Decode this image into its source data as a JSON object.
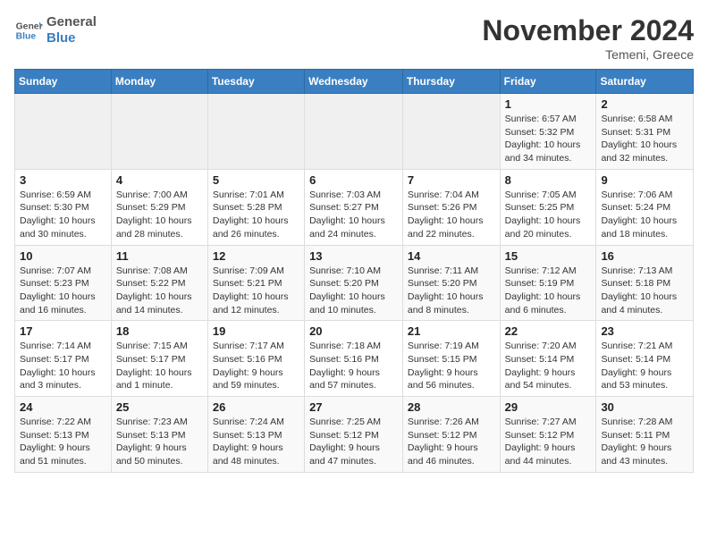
{
  "logo": {
    "text_general": "General",
    "text_blue": "Blue"
  },
  "title": "November 2024",
  "location": "Temeni, Greece",
  "days_of_week": [
    "Sunday",
    "Monday",
    "Tuesday",
    "Wednesday",
    "Thursday",
    "Friday",
    "Saturday"
  ],
  "weeks": [
    [
      {
        "day": "",
        "info": ""
      },
      {
        "day": "",
        "info": ""
      },
      {
        "day": "",
        "info": ""
      },
      {
        "day": "",
        "info": ""
      },
      {
        "day": "",
        "info": ""
      },
      {
        "day": "1",
        "info": "Sunrise: 6:57 AM\nSunset: 5:32 PM\nDaylight: 10 hours and 34 minutes."
      },
      {
        "day": "2",
        "info": "Sunrise: 6:58 AM\nSunset: 5:31 PM\nDaylight: 10 hours and 32 minutes."
      }
    ],
    [
      {
        "day": "3",
        "info": "Sunrise: 6:59 AM\nSunset: 5:30 PM\nDaylight: 10 hours and 30 minutes."
      },
      {
        "day": "4",
        "info": "Sunrise: 7:00 AM\nSunset: 5:29 PM\nDaylight: 10 hours and 28 minutes."
      },
      {
        "day": "5",
        "info": "Sunrise: 7:01 AM\nSunset: 5:28 PM\nDaylight: 10 hours and 26 minutes."
      },
      {
        "day": "6",
        "info": "Sunrise: 7:03 AM\nSunset: 5:27 PM\nDaylight: 10 hours and 24 minutes."
      },
      {
        "day": "7",
        "info": "Sunrise: 7:04 AM\nSunset: 5:26 PM\nDaylight: 10 hours and 22 minutes."
      },
      {
        "day": "8",
        "info": "Sunrise: 7:05 AM\nSunset: 5:25 PM\nDaylight: 10 hours and 20 minutes."
      },
      {
        "day": "9",
        "info": "Sunrise: 7:06 AM\nSunset: 5:24 PM\nDaylight: 10 hours and 18 minutes."
      }
    ],
    [
      {
        "day": "10",
        "info": "Sunrise: 7:07 AM\nSunset: 5:23 PM\nDaylight: 10 hours and 16 minutes."
      },
      {
        "day": "11",
        "info": "Sunrise: 7:08 AM\nSunset: 5:22 PM\nDaylight: 10 hours and 14 minutes."
      },
      {
        "day": "12",
        "info": "Sunrise: 7:09 AM\nSunset: 5:21 PM\nDaylight: 10 hours and 12 minutes."
      },
      {
        "day": "13",
        "info": "Sunrise: 7:10 AM\nSunset: 5:20 PM\nDaylight: 10 hours and 10 minutes."
      },
      {
        "day": "14",
        "info": "Sunrise: 7:11 AM\nSunset: 5:20 PM\nDaylight: 10 hours and 8 minutes."
      },
      {
        "day": "15",
        "info": "Sunrise: 7:12 AM\nSunset: 5:19 PM\nDaylight: 10 hours and 6 minutes."
      },
      {
        "day": "16",
        "info": "Sunrise: 7:13 AM\nSunset: 5:18 PM\nDaylight: 10 hours and 4 minutes."
      }
    ],
    [
      {
        "day": "17",
        "info": "Sunrise: 7:14 AM\nSunset: 5:17 PM\nDaylight: 10 hours and 3 minutes."
      },
      {
        "day": "18",
        "info": "Sunrise: 7:15 AM\nSunset: 5:17 PM\nDaylight: 10 hours and 1 minute."
      },
      {
        "day": "19",
        "info": "Sunrise: 7:17 AM\nSunset: 5:16 PM\nDaylight: 9 hours and 59 minutes."
      },
      {
        "day": "20",
        "info": "Sunrise: 7:18 AM\nSunset: 5:16 PM\nDaylight: 9 hours and 57 minutes."
      },
      {
        "day": "21",
        "info": "Sunrise: 7:19 AM\nSunset: 5:15 PM\nDaylight: 9 hours and 56 minutes."
      },
      {
        "day": "22",
        "info": "Sunrise: 7:20 AM\nSunset: 5:14 PM\nDaylight: 9 hours and 54 minutes."
      },
      {
        "day": "23",
        "info": "Sunrise: 7:21 AM\nSunset: 5:14 PM\nDaylight: 9 hours and 53 minutes."
      }
    ],
    [
      {
        "day": "24",
        "info": "Sunrise: 7:22 AM\nSunset: 5:13 PM\nDaylight: 9 hours and 51 minutes."
      },
      {
        "day": "25",
        "info": "Sunrise: 7:23 AM\nSunset: 5:13 PM\nDaylight: 9 hours and 50 minutes."
      },
      {
        "day": "26",
        "info": "Sunrise: 7:24 AM\nSunset: 5:13 PM\nDaylight: 9 hours and 48 minutes."
      },
      {
        "day": "27",
        "info": "Sunrise: 7:25 AM\nSunset: 5:12 PM\nDaylight: 9 hours and 47 minutes."
      },
      {
        "day": "28",
        "info": "Sunrise: 7:26 AM\nSunset: 5:12 PM\nDaylight: 9 hours and 46 minutes."
      },
      {
        "day": "29",
        "info": "Sunrise: 7:27 AM\nSunset: 5:12 PM\nDaylight: 9 hours and 44 minutes."
      },
      {
        "day": "30",
        "info": "Sunrise: 7:28 AM\nSunset: 5:11 PM\nDaylight: 9 hours and 43 minutes."
      }
    ]
  ]
}
